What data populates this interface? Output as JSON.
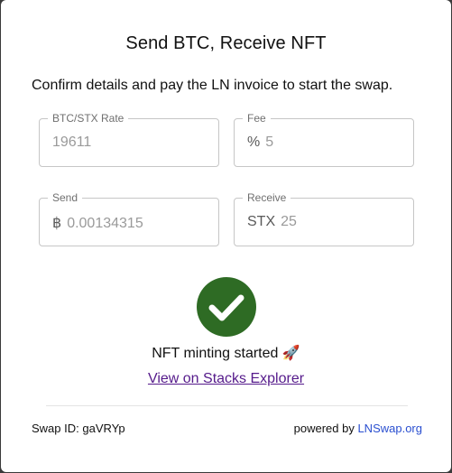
{
  "dialog": {
    "title": "Send BTC, Receive NFT",
    "description": "Confirm details and pay the LN invoice to start the swap."
  },
  "fields": {
    "rate": {
      "label": "BTC/STX Rate",
      "prefix": "",
      "value": "19611"
    },
    "fee": {
      "label": "Fee",
      "prefix": "%",
      "value": "5"
    },
    "send": {
      "label": "Send",
      "prefix": "฿",
      "value": "0.00134315"
    },
    "receive": {
      "label": "Receive",
      "prefix": "STX",
      "value": "25"
    }
  },
  "status": {
    "text": "NFT minting started 🚀",
    "icon": "check-circle-icon",
    "icon_color": "#2e6b24",
    "explorer_link": "View on Stacks Explorer"
  },
  "footer": {
    "swap_id": "Swap ID: gaVRYp",
    "powered_prefix": "powered by ",
    "powered_link": "LNSwap.org",
    "link_color": "#2a4fd0"
  }
}
